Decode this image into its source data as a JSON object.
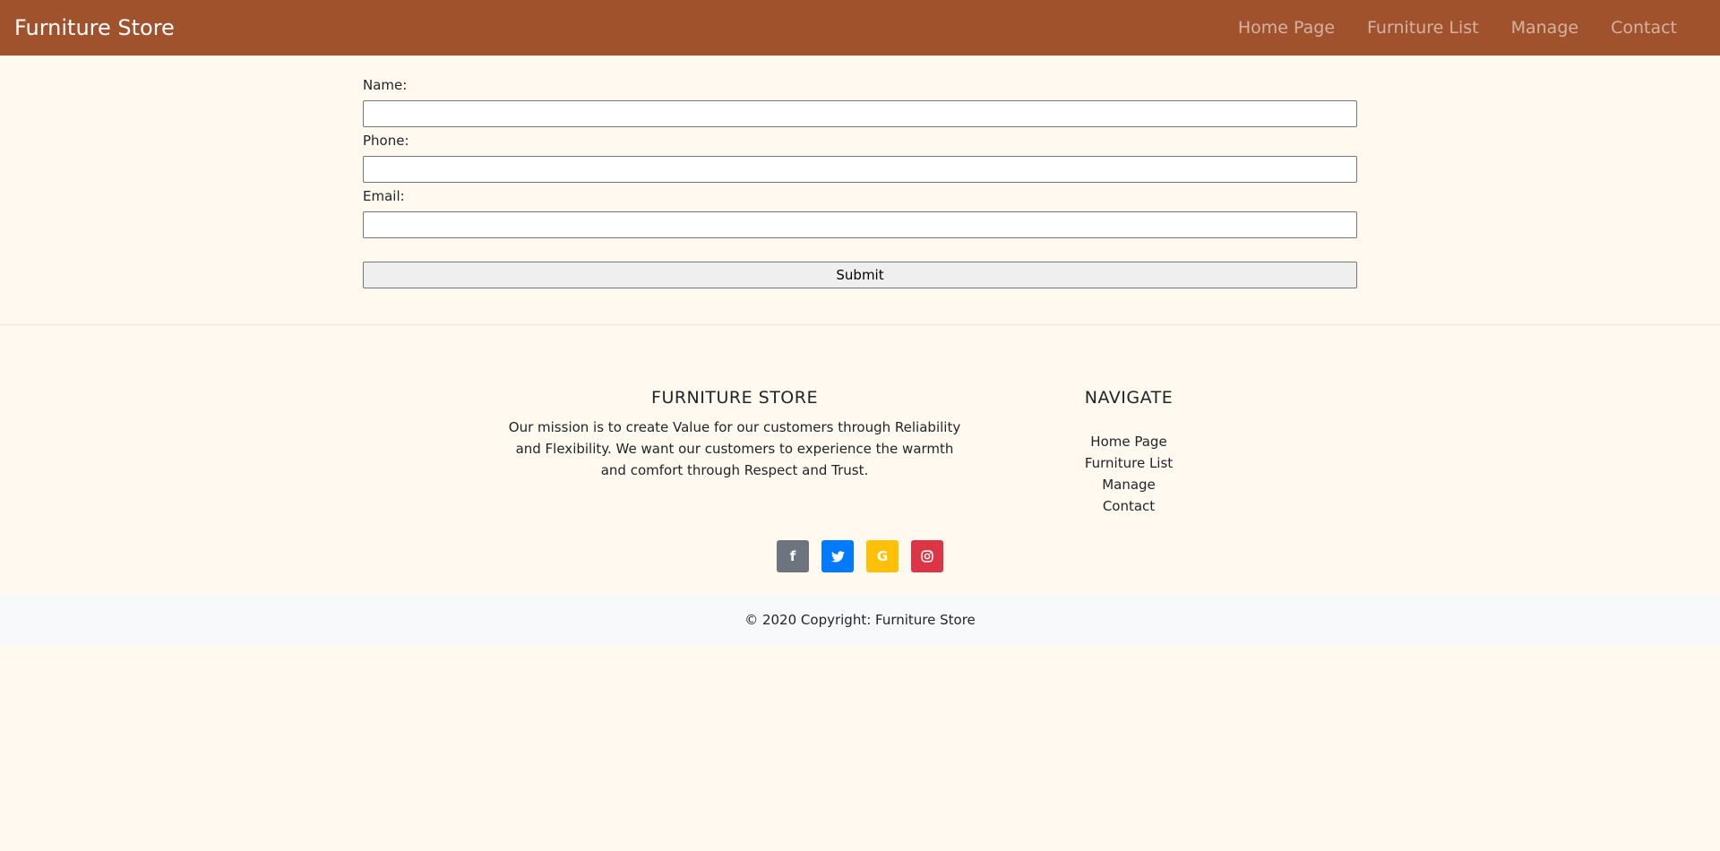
{
  "navbar": {
    "brand": "Furniture Store",
    "links": [
      "Home Page",
      "Furniture List",
      "Manage",
      "Contact"
    ]
  },
  "form": {
    "name_label": "Name:",
    "name_value": "",
    "phone_label": "Phone:",
    "phone_value": "",
    "email_label": "Email:",
    "email_value": "",
    "submit_label": "Submit"
  },
  "footer": {
    "about_heading": "FURNITURE STORE",
    "about_text": "Our mission is to create Value for our customers through Reliability and Flexibility. We want our customers to experience the warmth and comfort through Respect and Trust.",
    "nav_heading": "NAVIGATE",
    "nav_links": [
      "Home Page",
      "Furniture List",
      "Manage",
      "Contact"
    ],
    "social": [
      {
        "icon": "facebook-icon",
        "glyph": "f",
        "color": "#6c757d"
      },
      {
        "icon": "twitter-icon",
        "glyph": "t",
        "color": "#007bff"
      },
      {
        "icon": "google-icon",
        "glyph": "G",
        "color": "#ffc107"
      },
      {
        "icon": "instagram-icon",
        "glyph": "◎",
        "color": "#dc3545"
      }
    ],
    "copyright": "© 2020 Copyright: Furniture Store"
  },
  "colors": {
    "navbar_bg": "#a0522d",
    "page_bg": "#fff9ef",
    "copyright_bg": "#f8f9fa"
  }
}
